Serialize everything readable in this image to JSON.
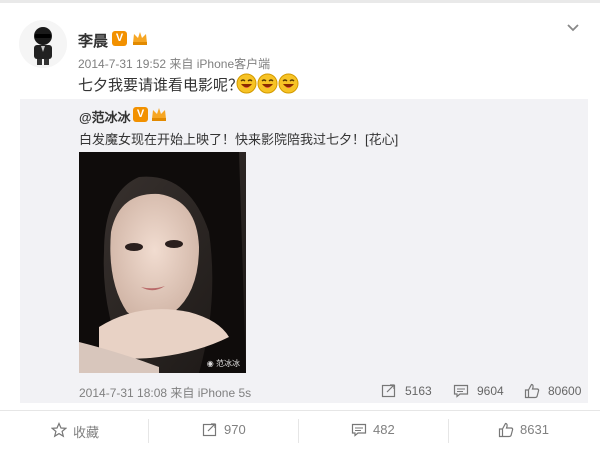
{
  "author": {
    "name": "李晨",
    "timestamp": "2014-7-31 19:52",
    "source": "来自 iPhone客户端",
    "text": "七夕我要请谁看电影呢？"
  },
  "repost": {
    "author": "@范冰冰",
    "text": "白发魔女现在开始上映了！快来影院陪我过七夕！[花心]",
    "timestamp": "2014-7-31 18:08",
    "source": "来自 iPhone 5s",
    "reposts": "5163",
    "comments": "9604",
    "likes": "80600",
    "icons": {
      "repost": "repost-icon",
      "comment": "comment-icon",
      "like": "thumbs-up-icon"
    }
  },
  "bottom_bar": {
    "favorite_label": "收藏",
    "reposts": "970",
    "comments": "482",
    "likes": "8631"
  },
  "colors": {
    "verified_badge": "#f29100",
    "meta_text": "#808080",
    "repost_bg": "#f2f2f5"
  }
}
